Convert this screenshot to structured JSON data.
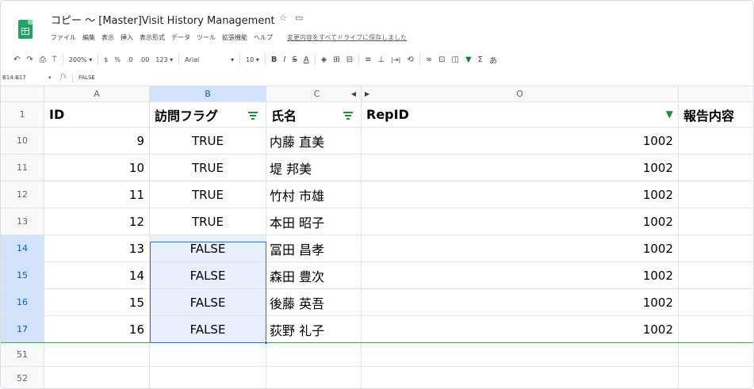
{
  "app": {
    "doc_title": "コピー 〜 [Master]Visit History Management",
    "star_icon": "star-icon",
    "folder_icon": "folder-icon"
  },
  "menu": {
    "items": [
      "ファイル",
      "編集",
      "表示",
      "挿入",
      "表示形式",
      "データ",
      "ツール",
      "拡張機能",
      "ヘルプ"
    ],
    "saved_status": "変更内容をすべてドライブに保存しました"
  },
  "toolbar": {
    "undo": "↶",
    "redo": "↷",
    "print": "⎙",
    "paint_format": "⍑",
    "zoom": "200%",
    "currency": "$",
    "percent": "%",
    "dec_decrease": ".0",
    "dec_increase": ".00",
    "more_formats": "123",
    "font": "Arial",
    "font_size": "10",
    "bold": "B",
    "italic": "I",
    "strike": "S",
    "text_color": "A",
    "fill": "◈",
    "borders": "⊞",
    "merge": "⊟",
    "halign": "≡",
    "valign": "⊥",
    "wrap": "|⇥|",
    "rotate": "⟲",
    "link": "∞",
    "comment": "⊡",
    "chart": "◫",
    "filter": "▼",
    "functions": "Σ",
    "input_tools": "あ"
  },
  "formula_bar": {
    "name_box": "B14:B17",
    "fx_label": "fx",
    "value": "FALSE"
  },
  "columns": [
    {
      "letter": "A",
      "selected": false
    },
    {
      "letter": "B",
      "selected": true
    },
    {
      "letter": "C",
      "selected": false
    },
    {
      "letter": "O",
      "selected": false
    }
  ],
  "header_row": {
    "row_number": "1",
    "id": "ID",
    "visit_flag": "訪問フラグ",
    "name": "氏名",
    "rep_id": "RepID",
    "report": "報告内容"
  },
  "rows": [
    {
      "row_number": "10",
      "id": "9",
      "flag": "TRUE",
      "name": "内藤 直美",
      "rep_id": "1002",
      "selected": false
    },
    {
      "row_number": "11",
      "id": "10",
      "flag": "TRUE",
      "name": "堤 邦美",
      "rep_id": "1002",
      "selected": false
    },
    {
      "row_number": "12",
      "id": "11",
      "flag": "TRUE",
      "name": "竹村 市雄",
      "rep_id": "1002",
      "selected": false
    },
    {
      "row_number": "13",
      "id": "12",
      "flag": "TRUE",
      "name": "本田 昭子",
      "rep_id": "1002",
      "selected": false
    },
    {
      "row_number": "14",
      "id": "13",
      "flag": "FALSE",
      "name": "冨田 昌孝",
      "rep_id": "1002",
      "selected": true
    },
    {
      "row_number": "15",
      "id": "14",
      "flag": "FALSE",
      "name": "森田 豊次",
      "rep_id": "1002",
      "selected": true
    },
    {
      "row_number": "16",
      "id": "15",
      "flag": "FALSE",
      "name": "後藤 英吾",
      "rep_id": "1002",
      "selected": true
    },
    {
      "row_number": "17",
      "id": "16",
      "flag": "FALSE",
      "name": "荻野 礼子",
      "rep_id": "1002",
      "selected": true
    }
  ],
  "empty_rows": [
    "51",
    "52"
  ],
  "colors": {
    "accent_green": "#1e8e3e",
    "selection_blue": "#1a73e8",
    "selection_fill": "#e8f0fe"
  }
}
